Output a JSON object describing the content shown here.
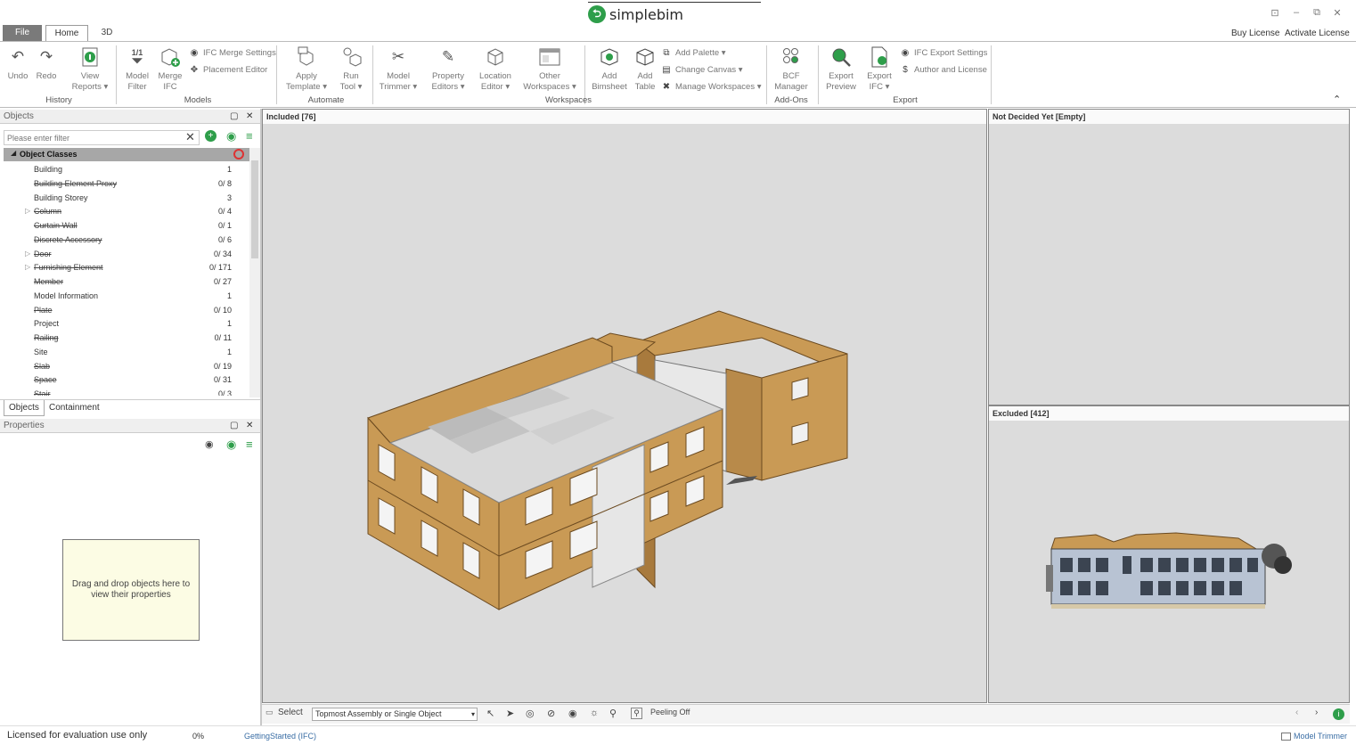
{
  "app": {
    "title": "simplebim",
    "logo_glyph": "⮌",
    "window_controls": [
      "⊡",
      "–",
      "⧉",
      "✕"
    ],
    "top_links": {
      "buy": "Buy License",
      "activate": "Activate License"
    }
  },
  "tabs": {
    "file": "File",
    "home": "Home",
    "three_d": "3D"
  },
  "ribbon": {
    "history": {
      "group": "History",
      "undo": "Undo",
      "redo": "Redo",
      "view_reports_1": "View",
      "view_reports_2": "Reports ▾"
    },
    "models": {
      "group": "Models",
      "model_filter_1": "Model",
      "model_filter_2": "Filter",
      "merge_ifc_1": "Merge",
      "merge_ifc_2": "IFC",
      "filter_badge": "1/1",
      "ifc_merge_settings": "IFC Merge Settings",
      "placement_editor": "Placement Editor"
    },
    "automate": {
      "group": "Automate",
      "apply_template_1": "Apply",
      "apply_template_2": "Template ▾",
      "run_tool_1": "Run",
      "run_tool_2": "Tool ▾"
    },
    "workspaces": {
      "group": "Workspaces",
      "model_trimmer_1": "Model",
      "model_trimmer_2": "Trimmer ▾",
      "property_editors_1": "Property",
      "property_editors_2": "Editors ▾",
      "location_editor_1": "Location",
      "location_editor_2": "Editor ▾",
      "other_workspaces_1": "Other",
      "other_workspaces_2": "Workspaces ▾",
      "add_bimsheet_1": "Add",
      "add_bimsheet_2": "Bimsheet",
      "add_table_1": "Add",
      "add_table_2": "Table",
      "add_palette": "Add Palette ▾",
      "change_canvas": "Change Canvas ▾",
      "manage_workspaces": "Manage Workspaces ▾"
    },
    "addons": {
      "group": "Add-Ons",
      "bcf_manager_1": "BCF",
      "bcf_manager_2": "Manager"
    },
    "export": {
      "group": "Export",
      "export_preview_1": "Export",
      "export_preview_2": "Preview",
      "export_ifc_1": "Export",
      "export_ifc_2": "IFC ▾",
      "ifc_export_settings": "IFC Export Settings",
      "author_license": "Author and License"
    },
    "collapse": "⌃"
  },
  "objects_panel": {
    "title": "Objects",
    "filter_placeholder": "Please enter filter",
    "root": "Object Classes",
    "items": [
      {
        "name": "Building",
        "count": "1",
        "excluded": false,
        "expand": ""
      },
      {
        "name": "Building Element Proxy",
        "count": "0/ 8",
        "excluded": true,
        "expand": ""
      },
      {
        "name": "Building Storey",
        "count": "3",
        "excluded": false,
        "expand": ""
      },
      {
        "name": "Column",
        "count": "0/ 4",
        "excluded": true,
        "expand": "▷"
      },
      {
        "name": "Curtain Wall",
        "count": "0/ 1",
        "excluded": true,
        "expand": ""
      },
      {
        "name": "Discrete Accessory",
        "count": "0/ 6",
        "excluded": true,
        "expand": ""
      },
      {
        "name": "Door",
        "count": "0/ 34",
        "excluded": true,
        "expand": "▷"
      },
      {
        "name": "Furnishing Element",
        "count": "0/ 171",
        "excluded": true,
        "expand": "▷"
      },
      {
        "name": "Member",
        "count": "0/ 27",
        "excluded": true,
        "expand": ""
      },
      {
        "name": "Model Information",
        "count": "1",
        "excluded": false,
        "expand": ""
      },
      {
        "name": "Plate",
        "count": "0/ 10",
        "excluded": true,
        "expand": ""
      },
      {
        "name": "Project",
        "count": "1",
        "excluded": false,
        "expand": ""
      },
      {
        "name": "Railing",
        "count": "0/ 11",
        "excluded": true,
        "expand": ""
      },
      {
        "name": "Site",
        "count": "1",
        "excluded": false,
        "expand": ""
      },
      {
        "name": "Slab",
        "count": "0/ 19",
        "excluded": true,
        "expand": ""
      },
      {
        "name": "Space",
        "count": "0/ 31",
        "excluded": true,
        "expand": ""
      },
      {
        "name": "Stair",
        "count": "0/ 3",
        "excluded": true,
        "expand": ""
      }
    ],
    "tabs": {
      "objects": "Objects",
      "containment": "Containment"
    }
  },
  "properties_panel": {
    "title": "Properties",
    "drop_hint": "Drag and drop objects here to view their properties"
  },
  "viewports": {
    "included": "Included [76]",
    "not_decided": "Not Decided Yet [Empty]",
    "excluded": "Excluded [412]"
  },
  "view_toolbar": {
    "select": "Select",
    "selection_mode": "Topmost Assembly or Single Object",
    "peeling": "Peeling Off"
  },
  "status": {
    "license": "Licensed for evaluation use only",
    "progress": "0%",
    "document": "GettingStarted (IFC)",
    "workspace": "Model Trimmer"
  },
  "colors": {
    "accent_green": "#2e9e4a",
    "wall_orange": "#c99a55",
    "viewport_bg": "#dcdcdc"
  }
}
